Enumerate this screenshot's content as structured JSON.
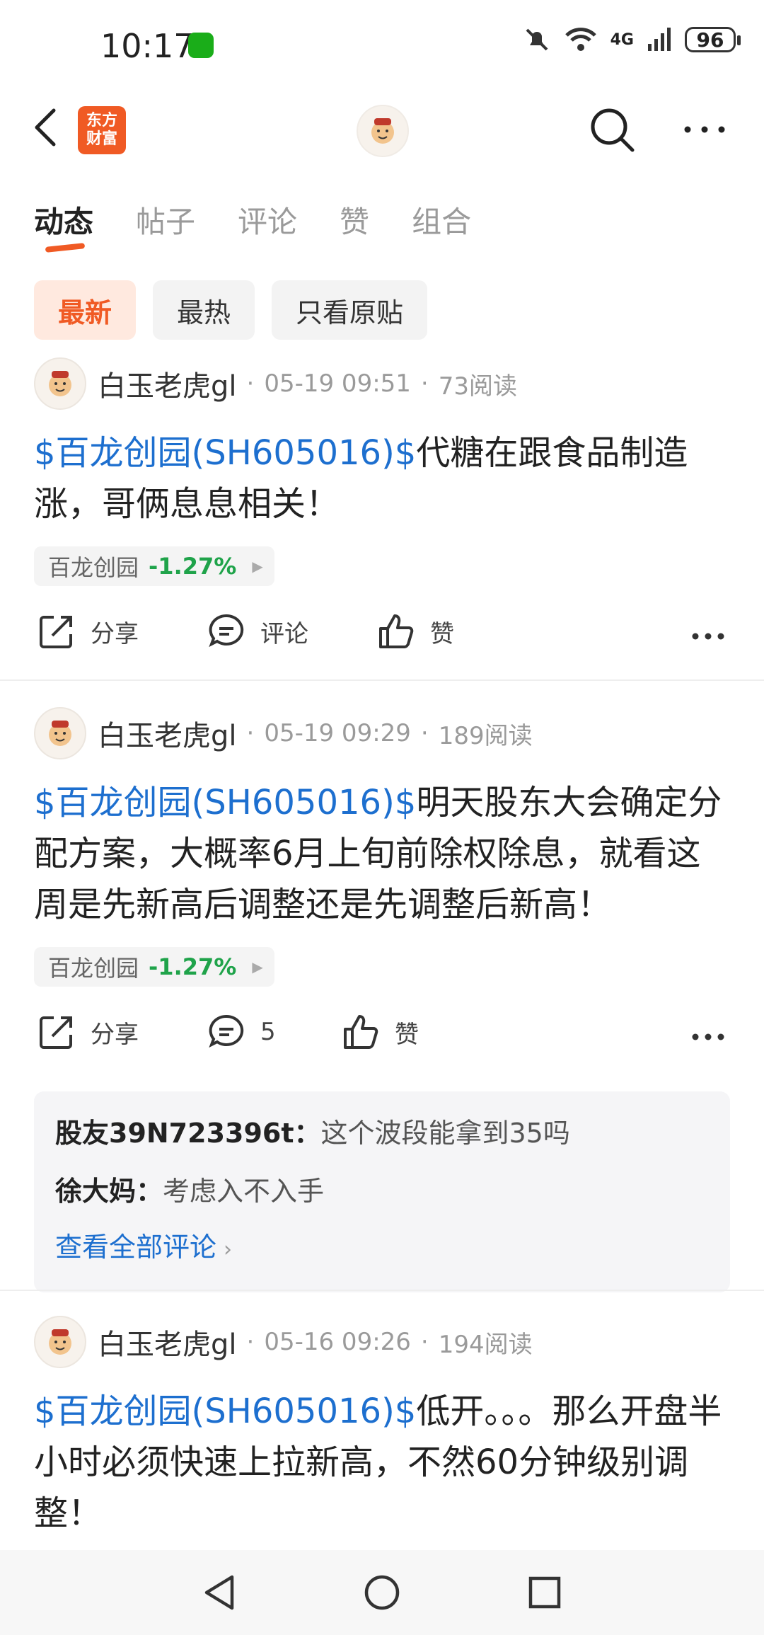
{
  "status_bar": {
    "time": "10:17",
    "network": "4G",
    "battery": "96"
  },
  "header": {
    "logo_line1": "东方",
    "logo_line2": "财富"
  },
  "tabs": [
    {
      "label": "动态",
      "active": true
    },
    {
      "label": "帖子",
      "active": false
    },
    {
      "label": "评论",
      "active": false
    },
    {
      "label": "赞",
      "active": false
    },
    {
      "label": "组合",
      "active": false
    }
  ],
  "filters": [
    {
      "label": "最新",
      "active": true
    },
    {
      "label": "最热",
      "active": false
    },
    {
      "label": "只看原贴",
      "active": false
    }
  ],
  "posts": [
    {
      "author": "白玉老虎gl",
      "time": "05-19 09:51",
      "reads": "73阅读",
      "stock_link": "$百龙创园(SH605016)$",
      "text": "代糖在跟食品制造涨，哥俩息息相关！",
      "stock_name": "百龙创园",
      "stock_change": "-1.27%",
      "share_label": "分享",
      "comment_label": "评论",
      "like_label": "赞"
    },
    {
      "author": "白玉老虎gl",
      "time": "05-19 09:29",
      "reads": "189阅读",
      "stock_link": "$百龙创园(SH605016)$",
      "text": "明天股东大会确定分配方案，大概率6月上旬前除权除息，就看这周是先新高后调整还是先调整后新高！",
      "stock_name": "百龙创园",
      "stock_change": "-1.27%",
      "share_label": "分享",
      "comment_label": "5",
      "like_label": "赞",
      "comments": [
        {
          "user": "股友39N723396t：",
          "text": "这个波段能拿到35吗"
        },
        {
          "user": "徐大妈：",
          "text": "考虑入不入手"
        }
      ],
      "view_all": "查看全部评论"
    },
    {
      "author": "白玉老虎gl",
      "time": "05-16 09:26",
      "reads": "194阅读",
      "stock_link": "$百龙创园(SH605016)$",
      "text": "低开。。。那么开盘半小时必须快速上拉新高，不然60分钟级别调整！"
    }
  ],
  "colors": {
    "accent": "#f05a24",
    "link": "#1d6fcf",
    "down": "#1fa34a"
  }
}
